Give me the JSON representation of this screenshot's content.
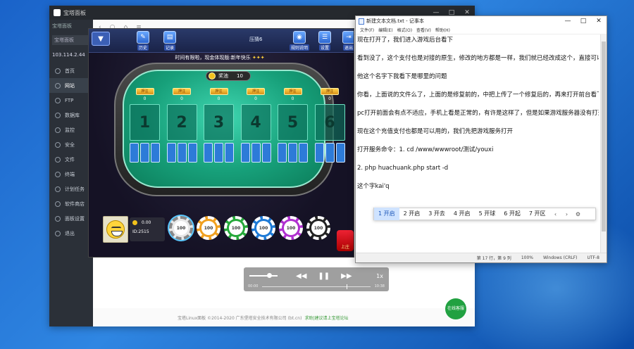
{
  "panel": {
    "tab_text": "宝塔面板",
    "address": "宝塔面板",
    "tab_pill": "宝塔面板",
    "host": "103.114.2.44",
    "nav": [
      {
        "label": "首页"
      },
      {
        "label": "网站"
      },
      {
        "label": "FTP"
      },
      {
        "label": "数据库"
      },
      {
        "label": "监控"
      },
      {
        "label": "安全"
      },
      {
        "label": "文件"
      },
      {
        "label": "终端"
      },
      {
        "label": "计划任务"
      },
      {
        "label": "软件商店"
      },
      {
        "label": "面板设置"
      },
      {
        "label": "退出"
      }
    ],
    "footer_text": "宝塔Linux面板 ©2014-2020 广东堡塔安全技术有限公司 (bt.cn)",
    "footer_link": "求助|建议请上宝塔论坛",
    "fab_label": "在线客服"
  },
  "player": {
    "current": "00:00",
    "total": "10:38",
    "rate": "1x",
    "progress": 0.78,
    "volume": 0.8
  },
  "game": {
    "top_icons": [
      {
        "label": "历史"
      },
      {
        "label": "记录"
      },
      {
        "label": "规则说明"
      },
      {
        "label": "设置"
      },
      {
        "label": "退出"
      }
    ],
    "title": "压猜6",
    "marquee": "时间有限啦，现金体现版:新年快乐",
    "pot_label": "奖池",
    "pot_value": "10",
    "bet_tag": "押注",
    "slots": [
      {
        "number": "1",
        "bet": "0"
      },
      {
        "number": "2",
        "bet": "0"
      },
      {
        "number": "3",
        "bet": "0"
      },
      {
        "number": "4",
        "bet": "0"
      },
      {
        "number": "5",
        "bet": "0"
      },
      {
        "number": "6",
        "bet": "0"
      }
    ],
    "player_coins": "0.00",
    "player_id": "ID:2515",
    "chips": [
      {
        "value": "100",
        "color": "#e8e8e8"
      },
      {
        "value": "100",
        "color": "#f0a020"
      },
      {
        "value": "100",
        "color": "#26a93a"
      },
      {
        "value": "100",
        "color": "#1e7ad6"
      },
      {
        "value": "100",
        "color": "#b030d0"
      },
      {
        "value": "100",
        "color": "#222222"
      }
    ],
    "chest_label": "上庄"
  },
  "notepad": {
    "title": "新建文本文档.txt - 记事本",
    "menu": [
      "文件(F)",
      "编辑(E)",
      "格式(O)",
      "查看(V)",
      "帮助(H)"
    ],
    "lines": [
      "现在打开了，我们进入游戏后台看下",
      "",
      "看到没了，这个支付也是对接的原生，修改的地方都是一样，我们就已经改成这个，直接可以用。",
      "",
      "他这个名字下我看下是哪里的问题",
      "",
      "你看，上面说的文件么了，上面的是修复前的，中把上传了一个修复后的，再来打开前台看下",
      "",
      "pc打开前面会有点不适应，手机上看是正常的，有许是这样了，但是如果游戏服务器没有打开",
      "",
      "现在这个充值支付也都是可以用的，我们先把游戏服务打开",
      "",
      "打开服务命令：1.    cd /www/wwwroot/测试/youxi",
      "",
      "                  2.      php huachuank.php start -d",
      "",
      "这个字kai'q"
    ],
    "status": [
      "第 17 行，第 9 列",
      "100%",
      "Windows (CRLF)",
      "UTF-8"
    ]
  },
  "ime": {
    "candidates": [
      "1 开启",
      "2 开启",
      "3 开去",
      "4 开启",
      "5 开球",
      "6 开起",
      "7 开区"
    ]
  }
}
